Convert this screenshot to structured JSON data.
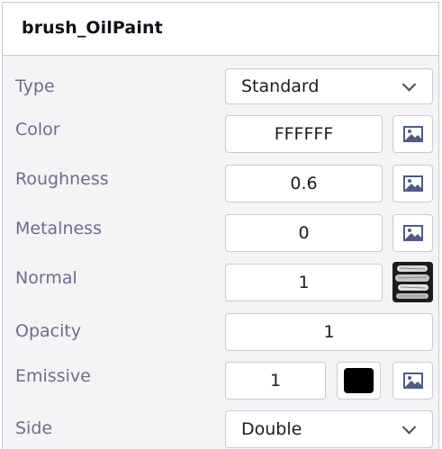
{
  "header": {
    "title": "brush_OilPaint"
  },
  "rows": {
    "type": {
      "label": "Type",
      "value": "Standard"
    },
    "color": {
      "label": "Color",
      "value": "FFFFFF"
    },
    "roughness": {
      "label": "Roughness",
      "value": "0.6"
    },
    "metalness": {
      "label": "Metalness",
      "value": "0"
    },
    "normal": {
      "label": "Normal",
      "value": "1"
    },
    "opacity": {
      "label": "Opacity",
      "value": "1"
    },
    "emissive": {
      "label": "Emissive",
      "value": "1",
      "swatch_color": "#000000"
    },
    "side": {
      "label": "Side",
      "value": "Double"
    }
  },
  "icons": {
    "texture_button": "image-icon",
    "dropdown": "chevron-down-icon"
  },
  "colors": {
    "label": "#6c6e8a",
    "border": "#c9c9d4",
    "panel_bg": "#f4f4f7"
  }
}
